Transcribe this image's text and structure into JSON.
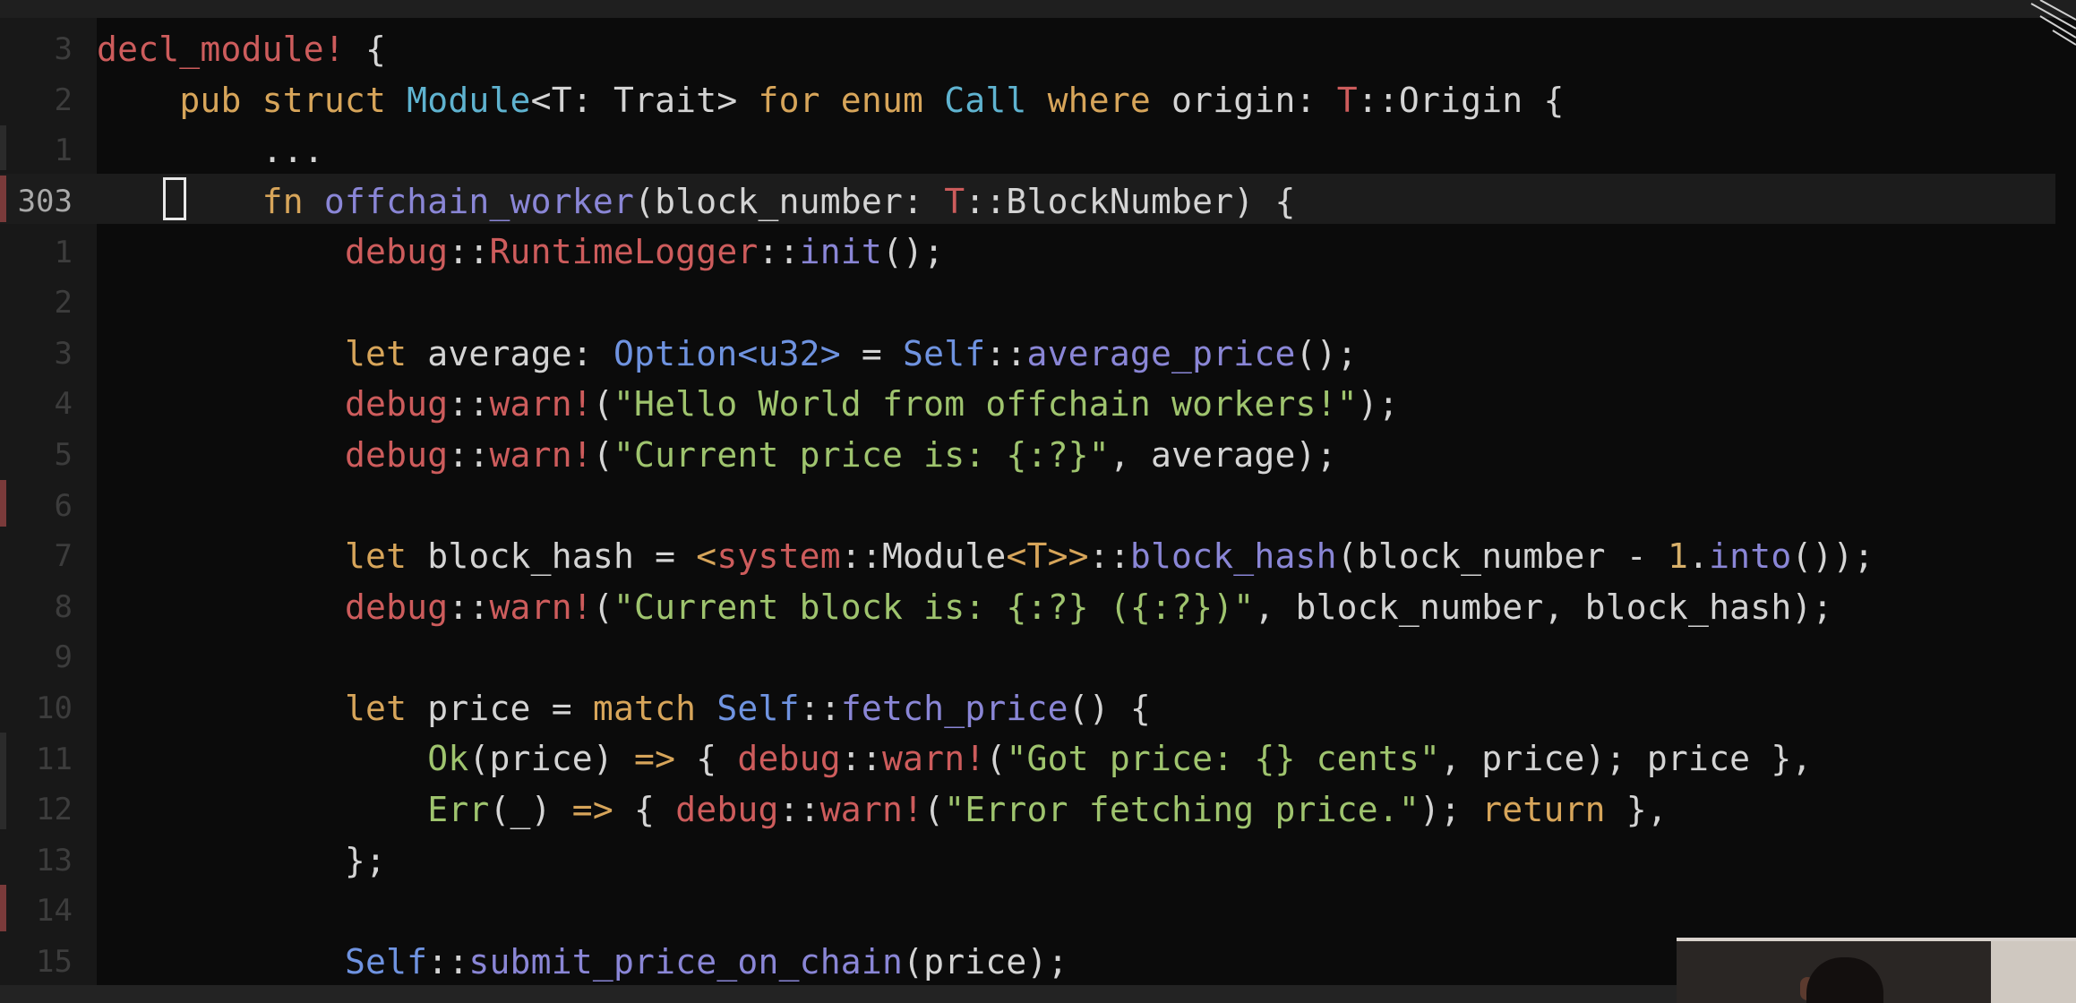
{
  "editor": {
    "current_line_number": "303",
    "lines": [
      {
        "ln": "3",
        "code": [
          {
            "t": "decl_module!",
            "c": "mac"
          },
          {
            "t": " {",
            "c": "plain"
          }
        ]
      },
      {
        "ln": "2",
        "code": [
          {
            "t": "    ",
            "c": "plain"
          },
          {
            "t": "pub struct",
            "c": "kw"
          },
          {
            "t": " ",
            "c": "plain"
          },
          {
            "t": "Module",
            "c": "ty"
          },
          {
            "t": "<T: Trait>",
            "c": "plain"
          },
          {
            "t": " ",
            "c": "plain"
          },
          {
            "t": "for enum",
            "c": "kw"
          },
          {
            "t": " ",
            "c": "plain"
          },
          {
            "t": "Call",
            "c": "ty"
          },
          {
            "t": " ",
            "c": "plain"
          },
          {
            "t": "where",
            "c": "kw"
          },
          {
            "t": " origin: ",
            "c": "plain"
          },
          {
            "t": "T",
            "c": "mac"
          },
          {
            "t": "::Origin {",
            "c": "plain"
          }
        ]
      },
      {
        "ln": "1",
        "code": [
          {
            "t": "        ...",
            "c": "plain"
          }
        ]
      },
      {
        "ln": "303",
        "code": [
          {
            "t": "        ",
            "c": "plain"
          },
          {
            "t": "fn",
            "c": "kw"
          },
          {
            "t": " ",
            "c": "plain"
          },
          {
            "t": "offchain_worker",
            "c": "fnc"
          },
          {
            "t": "(block_number: ",
            "c": "plain"
          },
          {
            "t": "T",
            "c": "mac"
          },
          {
            "t": "::BlockNumber) {",
            "c": "plain"
          }
        ]
      },
      {
        "ln": "1",
        "code": [
          {
            "t": "            ",
            "c": "plain"
          },
          {
            "t": "debug",
            "c": "mac"
          },
          {
            "t": "::",
            "c": "plain"
          },
          {
            "t": "RuntimeLogger",
            "c": "mac"
          },
          {
            "t": "::",
            "c": "plain"
          },
          {
            "t": "init",
            "c": "fnc"
          },
          {
            "t": "();",
            "c": "plain"
          }
        ]
      },
      {
        "ln": "2",
        "code": []
      },
      {
        "ln": "3",
        "code": [
          {
            "t": "            ",
            "c": "plain"
          },
          {
            "t": "let",
            "c": "kw"
          },
          {
            "t": " average: ",
            "c": "plain"
          },
          {
            "t": "Option<u32>",
            "c": "selfc"
          },
          {
            "t": " = ",
            "c": "plain"
          },
          {
            "t": "Self",
            "c": "selfc"
          },
          {
            "t": "::",
            "c": "plain"
          },
          {
            "t": "average_price",
            "c": "fnc"
          },
          {
            "t": "();",
            "c": "plain"
          }
        ]
      },
      {
        "ln": "4",
        "code": [
          {
            "t": "            ",
            "c": "plain"
          },
          {
            "t": "debug",
            "c": "mac"
          },
          {
            "t": "::",
            "c": "plain"
          },
          {
            "t": "warn!",
            "c": "mac"
          },
          {
            "t": "(",
            "c": "plain"
          },
          {
            "t": "\"Hello World from offchain workers!\"",
            "c": "str"
          },
          {
            "t": ");",
            "c": "plain"
          }
        ]
      },
      {
        "ln": "5",
        "code": [
          {
            "t": "            ",
            "c": "plain"
          },
          {
            "t": "debug",
            "c": "mac"
          },
          {
            "t": "::",
            "c": "plain"
          },
          {
            "t": "warn!",
            "c": "mac"
          },
          {
            "t": "(",
            "c": "plain"
          },
          {
            "t": "\"Current price is: {:?}\"",
            "c": "str"
          },
          {
            "t": ", average);",
            "c": "plain"
          }
        ]
      },
      {
        "ln": "6",
        "code": []
      },
      {
        "ln": "7",
        "code": [
          {
            "t": "            ",
            "c": "plain"
          },
          {
            "t": "let",
            "c": "kw"
          },
          {
            "t": " block_hash = ",
            "c": "plain"
          },
          {
            "t": "<",
            "c": "kw"
          },
          {
            "t": "system",
            "c": "mac"
          },
          {
            "t": "::Module",
            "c": "plain"
          },
          {
            "t": "<T>>",
            "c": "kw"
          },
          {
            "t": "::",
            "c": "plain"
          },
          {
            "t": "block_hash",
            "c": "fnc"
          },
          {
            "t": "(block_number - ",
            "c": "plain"
          },
          {
            "t": "1",
            "c": "num"
          },
          {
            "t": ".",
            "c": "plain"
          },
          {
            "t": "into",
            "c": "fnc"
          },
          {
            "t": "());",
            "c": "plain"
          }
        ]
      },
      {
        "ln": "8",
        "code": [
          {
            "t": "            ",
            "c": "plain"
          },
          {
            "t": "debug",
            "c": "mac"
          },
          {
            "t": "::",
            "c": "plain"
          },
          {
            "t": "warn!",
            "c": "mac"
          },
          {
            "t": "(",
            "c": "plain"
          },
          {
            "t": "\"Current block is: {:?} ({:?})\"",
            "c": "str"
          },
          {
            "t": ", block_number, block_hash);",
            "c": "plain"
          }
        ]
      },
      {
        "ln": "9",
        "code": []
      },
      {
        "ln": "10",
        "code": [
          {
            "t": "            ",
            "c": "plain"
          },
          {
            "t": "let",
            "c": "kw"
          },
          {
            "t": " price = ",
            "c": "plain"
          },
          {
            "t": "match",
            "c": "kw"
          },
          {
            "t": " ",
            "c": "plain"
          },
          {
            "t": "Self",
            "c": "selfc"
          },
          {
            "t": "::",
            "c": "plain"
          },
          {
            "t": "fetch_price",
            "c": "fnc"
          },
          {
            "t": "() {",
            "c": "plain"
          }
        ]
      },
      {
        "ln": "11",
        "code": [
          {
            "t": "                ",
            "c": "plain"
          },
          {
            "t": "Ok",
            "c": "str"
          },
          {
            "t": "(price) ",
            "c": "plain"
          },
          {
            "t": "=>",
            "c": "kw"
          },
          {
            "t": " { ",
            "c": "plain"
          },
          {
            "t": "debug",
            "c": "mac"
          },
          {
            "t": "::",
            "c": "plain"
          },
          {
            "t": "warn!",
            "c": "mac"
          },
          {
            "t": "(",
            "c": "plain"
          },
          {
            "t": "\"Got price: {} cents\"",
            "c": "str"
          },
          {
            "t": ", price); price },",
            "c": "plain"
          }
        ]
      },
      {
        "ln": "12",
        "code": [
          {
            "t": "                ",
            "c": "plain"
          },
          {
            "t": "Err",
            "c": "str"
          },
          {
            "t": "(_) ",
            "c": "plain"
          },
          {
            "t": "=>",
            "c": "kw"
          },
          {
            "t": " { ",
            "c": "plain"
          },
          {
            "t": "debug",
            "c": "mac"
          },
          {
            "t": "::",
            "c": "plain"
          },
          {
            "t": "warn!",
            "c": "mac"
          },
          {
            "t": "(",
            "c": "plain"
          },
          {
            "t": "\"Error fetching price.\"",
            "c": "str"
          },
          {
            "t": "); ",
            "c": "plain"
          },
          {
            "t": "return",
            "c": "kw"
          },
          {
            "t": " },",
            "c": "plain"
          }
        ]
      },
      {
        "ln": "13",
        "code": [
          {
            "t": "            };",
            "c": "plain"
          }
        ]
      },
      {
        "ln": "14",
        "code": []
      },
      {
        "ln": "15",
        "code": [
          {
            "t": "            ",
            "c": "plain"
          },
          {
            "t": "Self",
            "c": "selfc"
          },
          {
            "t": "::",
            "c": "plain"
          },
          {
            "t": "submit_price_on_chain",
            "c": "fnc"
          },
          {
            "t": "(price);",
            "c": "plain"
          }
        ]
      }
    ]
  },
  "colors": {
    "keyword": "#d7a55a",
    "macro": "#cd5c5c",
    "type": "#5fb3d0",
    "string": "#9fc46e",
    "function": "#8a86d6",
    "self": "#6f93e0",
    "background": "#0b0b0b",
    "gutter": "#181818"
  }
}
